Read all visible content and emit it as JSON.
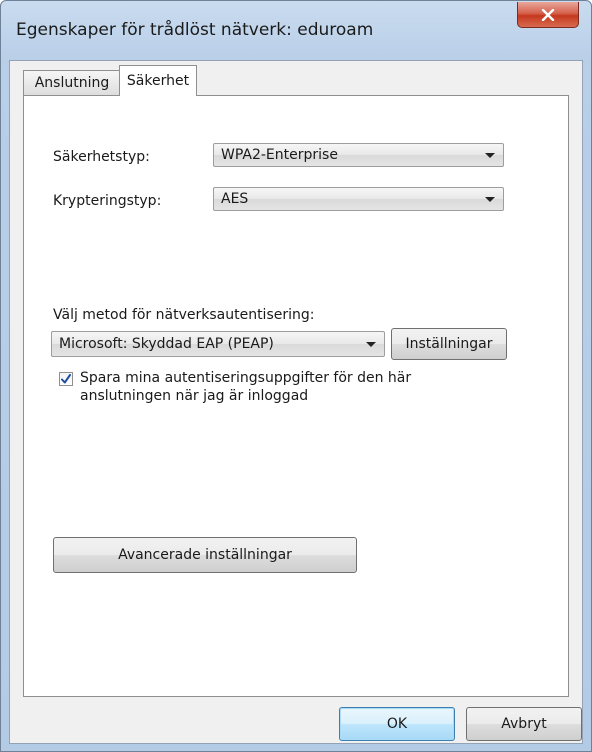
{
  "window": {
    "title": "Egenskaper för trådlöst nätverk: eduroam"
  },
  "tabs": [
    {
      "label": "Anslutning",
      "active": false
    },
    {
      "label": "Säkerhet",
      "active": true
    }
  ],
  "security": {
    "security_type_label": "Säkerhetstyp:",
    "security_type_value": "WPA2-Enterprise",
    "encryption_type_label": "Krypteringstyp:",
    "encryption_type_value": "AES"
  },
  "authentication": {
    "method_label": "Välj metod för nätverksautentisering:",
    "method_value": "Microsoft: Skyddad EAP (PEAP)",
    "settings_button": "Inställningar",
    "remember_checked": true,
    "remember_label": "Spara mina autentiseringsuppgifter för den här anslutningen när jag är inloggad"
  },
  "advanced_button": "Avancerade inställningar",
  "footer": {
    "ok_button": "OK",
    "cancel_button": "Avbryt"
  },
  "colors": {
    "title_bar": "#b9cfe8",
    "close_button": "#c5391f",
    "checkmark": "#1f4fa0"
  },
  "icons": {
    "close": "close-icon",
    "dropdown": "chevron-down-icon",
    "check": "checkmark-icon"
  }
}
